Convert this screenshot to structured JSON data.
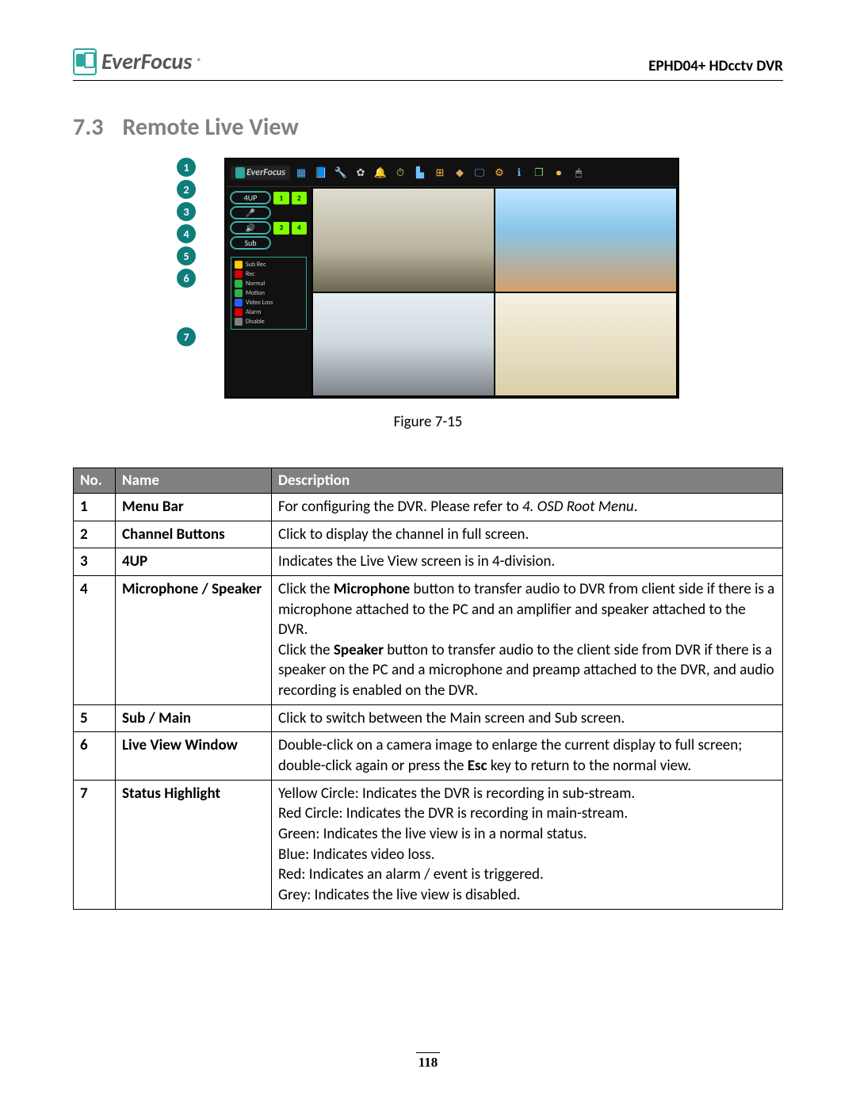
{
  "header": {
    "brand": "EverFocus",
    "product": "EPHD04+  HDcctv DVR"
  },
  "section": {
    "number": "7.3",
    "title": "Remote Live View"
  },
  "figure": {
    "caption": "Figure 7-15",
    "callouts": [
      "1",
      "2",
      "3",
      "4",
      "5",
      "6",
      "7"
    ],
    "toolbar_logo": "EverFocus",
    "toolbar_icons": [
      {
        "name": "layout-icon",
        "glyph": "▦",
        "color": "#4db3ff"
      },
      {
        "name": "book-icon",
        "glyph": "📘",
        "color": "#ffae42"
      },
      {
        "name": "wrench-icon",
        "glyph": "🔧",
        "color": "#aaa"
      },
      {
        "name": "film-icon",
        "glyph": "✿",
        "color": "#ccc"
      },
      {
        "name": "bell-icon",
        "glyph": "🔔",
        "color": "#ffd24d"
      },
      {
        "name": "clock-icon",
        "glyph": "⏱",
        "color": "#c7e37e"
      },
      {
        "name": "network-icon",
        "glyph": "▙",
        "color": "#6ec1ff"
      },
      {
        "name": "grid-icon",
        "glyph": "⊞",
        "color": "#ffb347"
      },
      {
        "name": "chip-icon",
        "glyph": "◆",
        "color": "#d9a760"
      },
      {
        "name": "monitor-icon",
        "glyph": "🖵",
        "color": "#4db3ff"
      },
      {
        "name": "gear-icon",
        "glyph": "⚙",
        "color": "#ffb347"
      },
      {
        "name": "info-icon",
        "glyph": "ℹ",
        "color": "#4db3ff"
      },
      {
        "name": "copy-icon",
        "glyph": "❐",
        "color": "#7fc97f"
      },
      {
        "name": "record-icon",
        "glyph": "●",
        "color": "#ffb347"
      },
      {
        "name": "mouse-icon",
        "glyph": "🖱",
        "color": "#ddd"
      }
    ],
    "side": {
      "fourup": "4UP",
      "mic": "🎤",
      "speaker": "🔊",
      "sub": "Sub",
      "channels": [
        "1",
        "2",
        "3",
        "4"
      ],
      "legend": [
        {
          "color": "#ffcc00",
          "label": "Sub Rec"
        },
        {
          "color": "#d80000",
          "label": "Rec"
        },
        {
          "color": "#2fb24c",
          "label": "Normal"
        },
        {
          "color": "#2fb24c",
          "label": "Motion"
        },
        {
          "color": "#2a5cff",
          "label": "Video Loss"
        },
        {
          "color": "#d80000",
          "label": "Alarm"
        },
        {
          "color": "#808080",
          "label": "Disable"
        }
      ]
    }
  },
  "table": {
    "head": {
      "no": "No.",
      "name": "Name",
      "desc": "Description"
    },
    "rows": [
      {
        "no": "1",
        "name": "Menu Bar",
        "desc": "For configuring the DVR. Please refer to <i>4. OSD Root Menu</i>."
      },
      {
        "no": "2",
        "name": "Channel Buttons",
        "desc": "Click to display the channel in full screen."
      },
      {
        "no": "3",
        "name": "4UP",
        "desc": "Indicates the Live View screen is in 4-division."
      },
      {
        "no": "4",
        "name": "Microphone / Speaker",
        "desc": "Click the <b>Microphone</b> button to transfer audio to DVR from client side if there is a microphone attached to the PC and an amplifier and speaker attached to the DVR.<br>Click the <b>Speaker</b> button to transfer audio to the client side from DVR if there is a speaker on the PC and a microphone and preamp attached to the DVR, and audio recording is enabled on the DVR."
      },
      {
        "no": "5",
        "name": "Sub / Main",
        "desc": "Click to switch between the Main screen and Sub screen."
      },
      {
        "no": "6",
        "name": "Live View Window",
        "desc": "Double-click on a camera image to enlarge the current display to full screen; double-click again or press the <b>Esc</b> key to return to the normal view."
      },
      {
        "no": "7",
        "name": "Status Highlight",
        "desc": "Yellow Circle: Indicates the DVR is recording in sub-stream.<br>Red Circle: Indicates the DVR is recording in main-stream.<br>Green: Indicates the live view is in a normal status.<br>Blue: Indicates video loss.<br>Red: Indicates an alarm / event is triggered.<br>Grey: Indicates the live view is disabled."
      }
    ]
  },
  "page_number": "118"
}
